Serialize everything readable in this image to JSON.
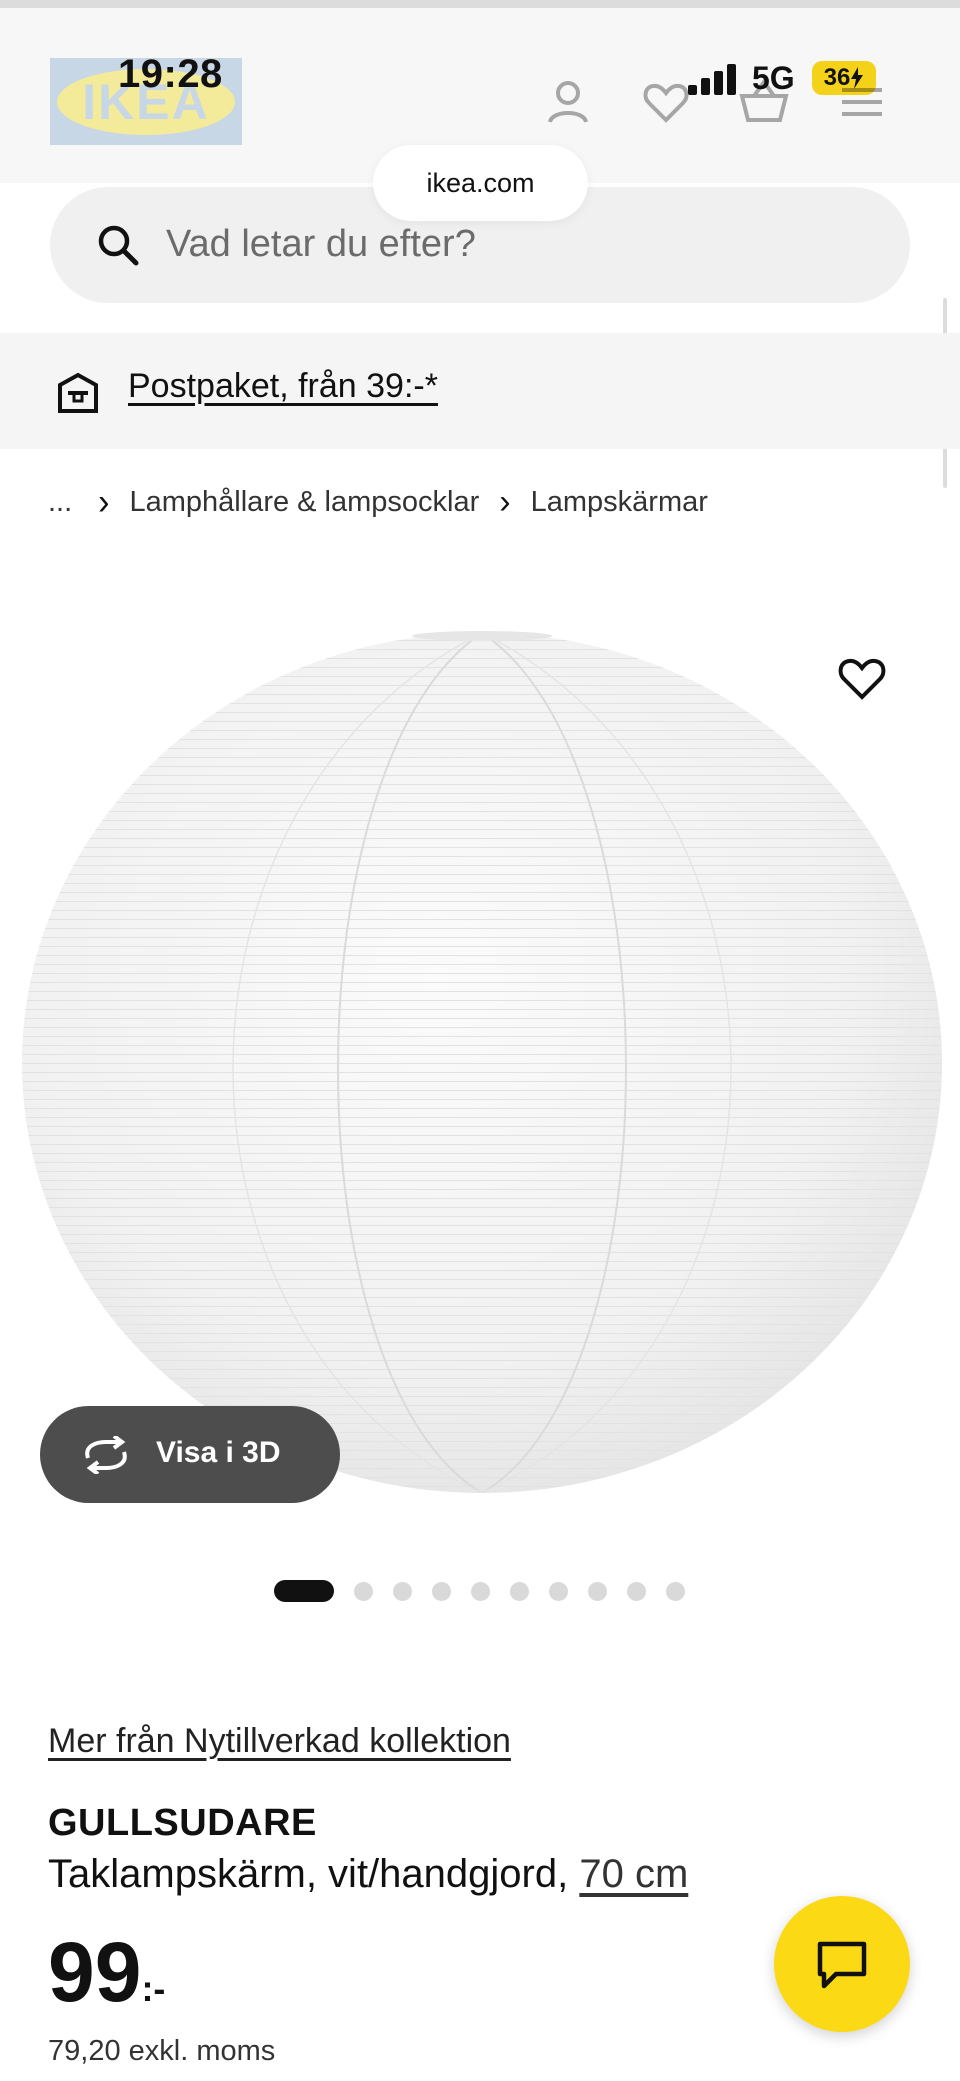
{
  "status_bar": {
    "time": "19:28",
    "network": "5G",
    "battery": "36"
  },
  "header": {
    "logo_text": "IKEA",
    "url": "ikea.com",
    "icons": [
      "account-icon",
      "heart-icon",
      "basket-icon",
      "menu-icon"
    ]
  },
  "search": {
    "placeholder": "Vad letar du efter?"
  },
  "delivery": {
    "text": "Postpaket, från 39:-*"
  },
  "breadcrumb": {
    "ellipsis": "...",
    "items": [
      "Lamphållare & lampsocklar",
      "Lampskärmar"
    ],
    "separator": "›"
  },
  "gallery": {
    "view_3d_label": "Visa i 3D",
    "total_images": 10,
    "active_index": 0
  },
  "product": {
    "collection_link": "Mer från Nytillverkad kollektion",
    "name": "GULLSUDARE",
    "description": "Taklampskärm, vit/handgjord,",
    "size": "70 cm",
    "price_integer": "99",
    "price_suffix": ":-",
    "price_excl_vat": "79,20 exkl. moms"
  },
  "colors": {
    "accent_yellow": "#fbd914",
    "logo_blue": "#c8d7e6",
    "button_dark": "#4d4d4d"
  }
}
